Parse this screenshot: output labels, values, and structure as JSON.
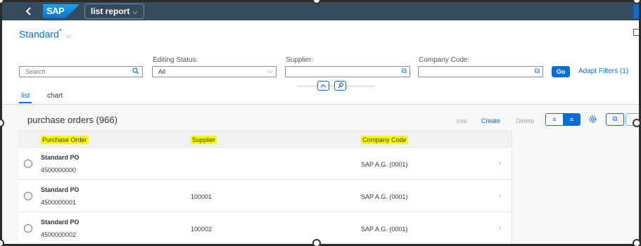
{
  "shell": {
    "back_icon": "chevron-left-icon",
    "logo": "SAP",
    "app_title": "list report",
    "app_menu_icon": "chevron-down-icon"
  },
  "filterbar": {
    "variant_name": "Standard",
    "variant_modified": "*",
    "search_placeholder": "Search",
    "editing_status_label": "Editing Status:",
    "editing_status_value": "All",
    "supplier_label": "Supplier:",
    "supplier_value": "",
    "company_code_label": "Company Code:",
    "company_code_value": "",
    "go_label": "Go",
    "adapt_label": "Adapt Filters (1)"
  },
  "tabs": [
    {
      "label": "list",
      "active": true
    },
    {
      "label": "chart",
      "active": false
    }
  ],
  "table": {
    "title": "purchase orders (966)",
    "toolbar": {
      "nav_label": "nav",
      "create_label": "Create",
      "delete_label": "Delete"
    },
    "columns": [
      "Purchase Order",
      "Supplier",
      "Company Code"
    ],
    "rows": [
      {
        "type": "Standard PO",
        "number": "4500000000",
        "supplier": "",
        "company": "SAP A.G. (0001)"
      },
      {
        "type": "Standard PO",
        "number": "4500000001",
        "supplier": "100001",
        "company": "SAP A.G. (0001)"
      },
      {
        "type": "Standard PO",
        "number": "4500000002",
        "supplier": "100002",
        "company": "SAP A.G. (0001)"
      }
    ]
  },
  "colors": {
    "shell": "#354a5f",
    "accent": "#0a6ed1",
    "highlight": "#ffff00"
  }
}
